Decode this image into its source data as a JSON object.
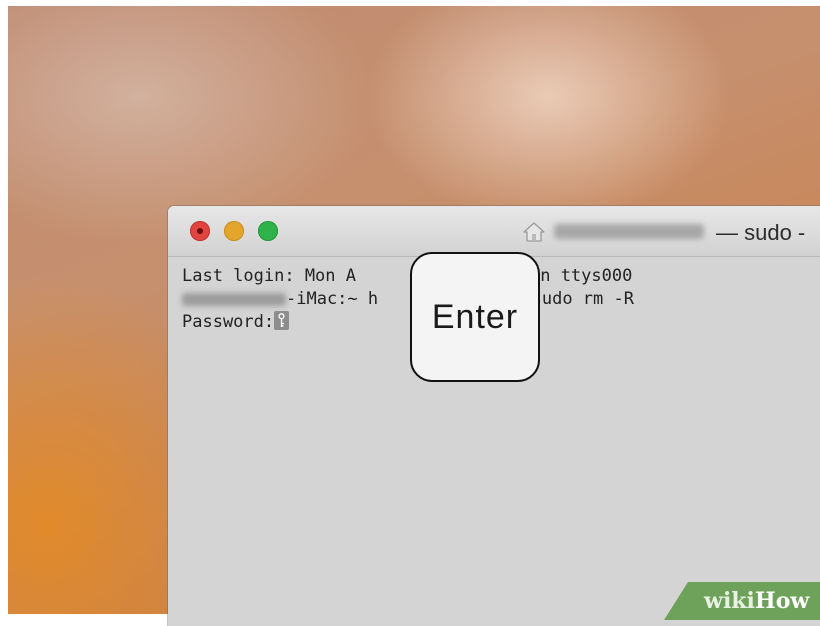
{
  "window": {
    "title_suffix": "— sudo -",
    "controls": [
      "close",
      "minimize",
      "zoom"
    ]
  },
  "terminal": {
    "line1": "Last login: Mon A           53:37 on ttys000",
    "line2_after_host": "-iMac:~ h           tt$ sudo rm -R",
    "line3_prompt": "Password:"
  },
  "overlay": {
    "key_label": "Enter"
  },
  "watermark": {
    "part1": "wiki",
    "part2": "How"
  },
  "colors": {
    "close": "#e0443e",
    "minimize": "#e3a52c",
    "zoom": "#2fb24a",
    "watermark_bg": "#6ea15a"
  },
  "icons": [
    "home-icon",
    "key-icon"
  ]
}
